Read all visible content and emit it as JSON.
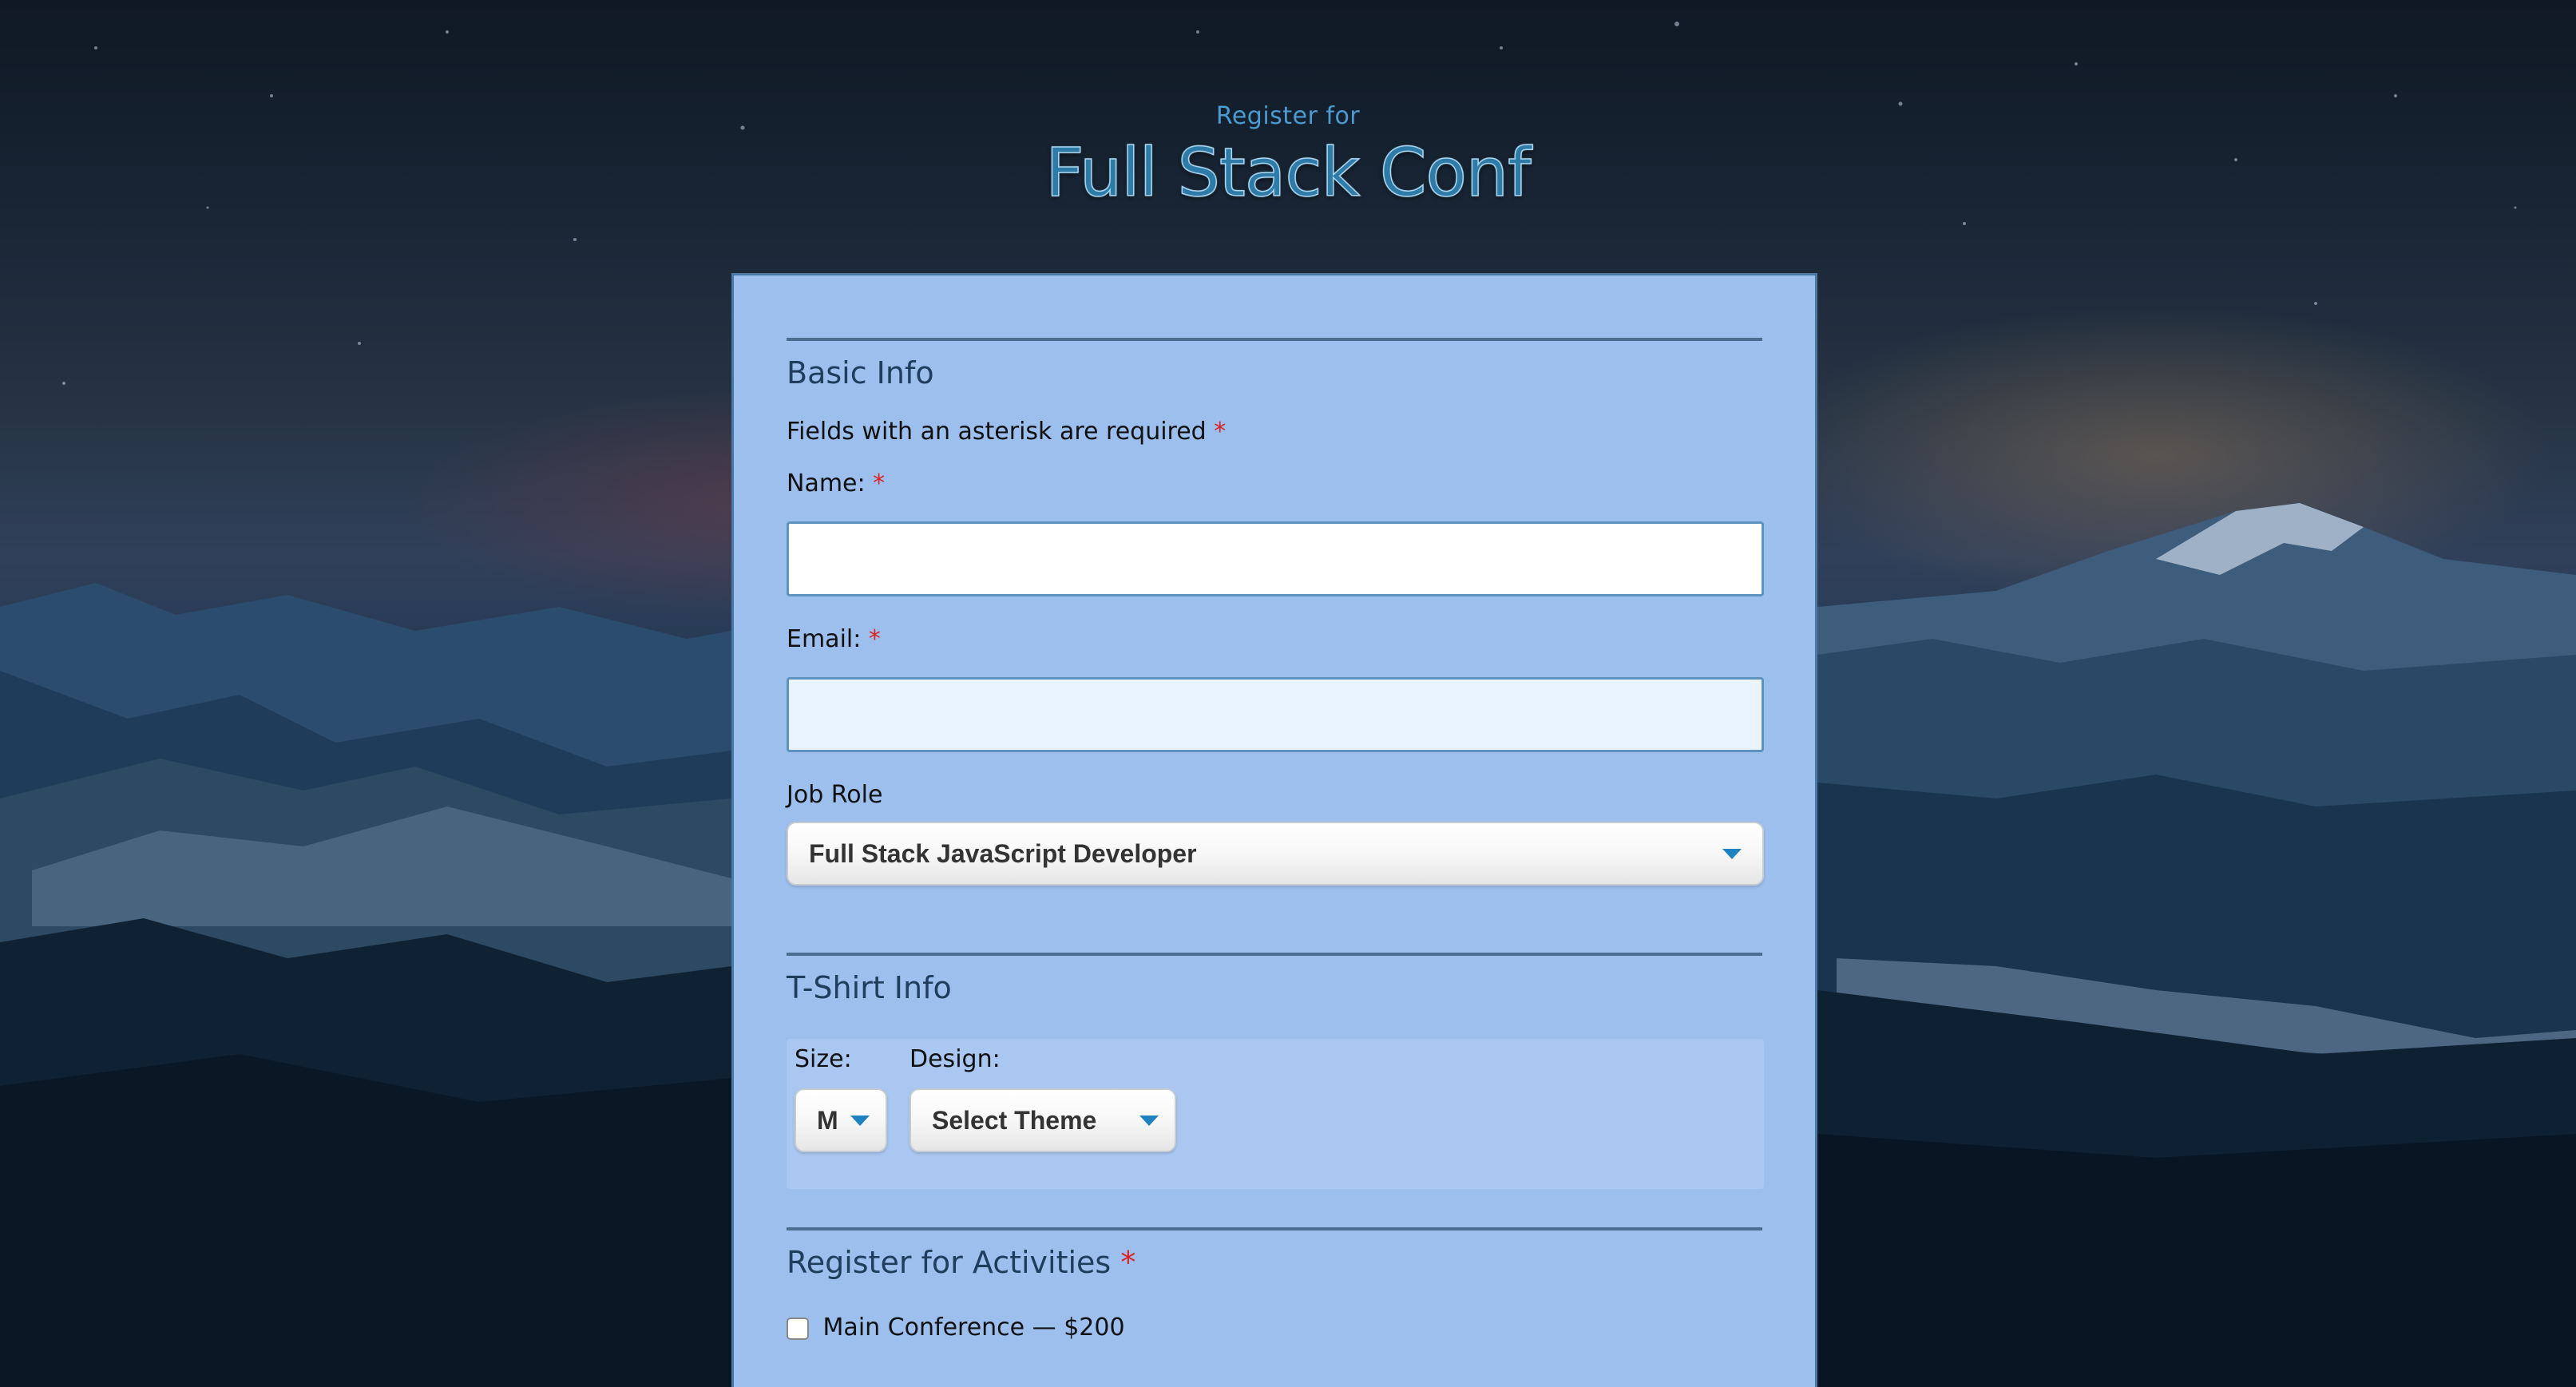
{
  "header": {
    "subtitle": "Register for",
    "title": "Full Stack Conf"
  },
  "basic_info": {
    "legend": "Basic Info",
    "required_note": "Fields with an asterisk are required",
    "required_marker": "*",
    "name_label": "Name:",
    "name_value": "",
    "email_label": "Email:",
    "email_value": "",
    "job_role_label": "Job Role",
    "job_role_selected": "Full Stack JavaScript Developer"
  },
  "tshirt_info": {
    "legend": "T-Shirt Info",
    "size_label": "Size:",
    "size_selected": "M",
    "design_label": "Design:",
    "design_selected": "Select Theme"
  },
  "activities": {
    "legend": "Register for Activities",
    "items": [
      {
        "label": "Main Conference — $200",
        "checked": false
      }
    ]
  },
  "colors": {
    "card_bg": "#9dbfee",
    "title": "#2f7ba8",
    "required": "#e02020",
    "accent_caret": "#1f82c0"
  },
  "icons": {
    "dropdown": "chevron-down-icon",
    "checkbox": "checkbox-icon"
  }
}
